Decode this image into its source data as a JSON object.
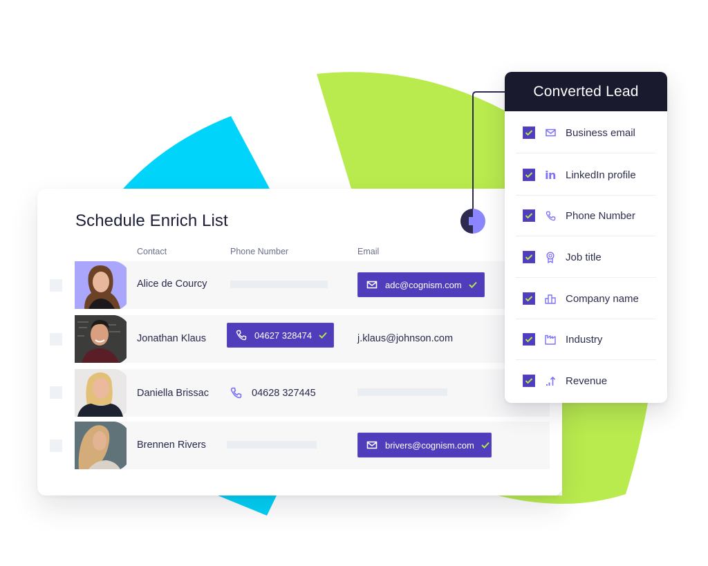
{
  "colors": {
    "accent_purple": "#4f3dbb",
    "icon_lavender": "#7b72f5",
    "check_green": "#b5e84c",
    "dark_navy": "#1a1a2e",
    "shape_lime": "#b9eb4e",
    "shape_cyan": "#00d4fb",
    "row_bg": "#f7f7f8",
    "placeholder_bar": "#eaedf1"
  },
  "list_card": {
    "title": "Schedule Enrich List",
    "columns": {
      "contact": "Contact",
      "phone": "Phone Number",
      "email": "Email"
    },
    "rows": [
      {
        "name": "Alice de Courcy",
        "avatar": "photo-woman-brown-hair-lavender-bg",
        "phone": null,
        "phone_state": "placeholder",
        "email": "adc@cognism.com",
        "email_state": "verified"
      },
      {
        "name": "Jonathan Klaus",
        "avatar": "photo-man-chalkboard-bg",
        "phone": "04627 328474",
        "phone_state": "verified",
        "email": "j.klaus@johnson.com",
        "email_state": "plain"
      },
      {
        "name": "Daniella Brissac",
        "avatar": "photo-woman-blonde-white-brick-bg",
        "phone": "04628 327445",
        "phone_state": "plain",
        "email": null,
        "email_state": "placeholder"
      },
      {
        "name": "Brennen Rivers",
        "avatar": "photo-woman-blonde-teal-bg",
        "phone": null,
        "phone_state": "placeholder",
        "email": "brivers@cognism.com",
        "email_state": "verified"
      }
    ]
  },
  "converted_panel": {
    "title": "Converted Lead",
    "items": [
      {
        "label": "Business email",
        "icon": "envelope-icon",
        "checked": true
      },
      {
        "label": "LinkedIn profile",
        "icon": "linkedin-icon",
        "icon_text": "in",
        "checked": true
      },
      {
        "label": "Phone Number",
        "icon": "phone-icon",
        "checked": true
      },
      {
        "label": "Job title",
        "icon": "badge-icon",
        "checked": true
      },
      {
        "label": "Company name",
        "icon": "buildings-icon",
        "checked": true
      },
      {
        "label": "Industry",
        "icon": "factory-icon",
        "checked": true
      },
      {
        "label": "Revenue",
        "icon": "revenue-growth-icon",
        "checked": true
      }
    ]
  }
}
